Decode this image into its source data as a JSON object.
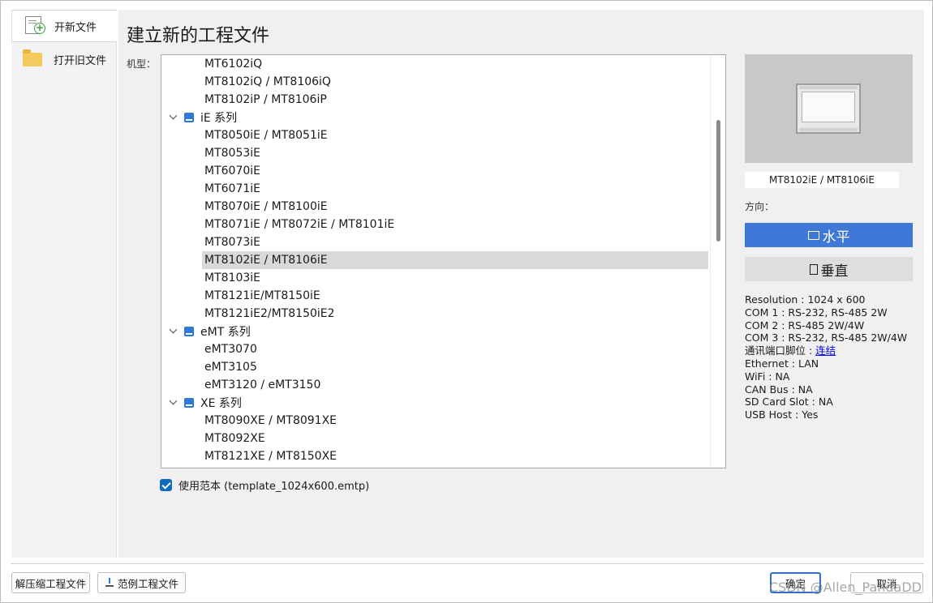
{
  "left_panel": {
    "new_file": "开新文件",
    "open_file": "打开旧文件"
  },
  "main": {
    "title": "建立新的工程文件",
    "model_label": "机型：",
    "tree": [
      {
        "type": "leaf",
        "label": "MT6102iQ"
      },
      {
        "type": "leaf",
        "label": "MT8102iQ / MT8106iQ"
      },
      {
        "type": "leaf",
        "label": "MT8102iP / MT8106iP"
      },
      {
        "type": "group",
        "label": "iE 系列"
      },
      {
        "type": "leaf",
        "label": "MT8050iE / MT8051iE"
      },
      {
        "type": "leaf",
        "label": "MT8053iE"
      },
      {
        "type": "leaf",
        "label": "MT6070iE"
      },
      {
        "type": "leaf",
        "label": "MT6071iE"
      },
      {
        "type": "leaf",
        "label": "MT8070iE / MT8100iE"
      },
      {
        "type": "leaf",
        "label": "MT8071iE / MT8072iE / MT8101iE"
      },
      {
        "type": "leaf",
        "label": "MT8073iE"
      },
      {
        "type": "leaf",
        "label": "MT8102iE / MT8106iE",
        "selected": true
      },
      {
        "type": "leaf",
        "label": "MT8103iE"
      },
      {
        "type": "leaf",
        "label": "MT8121iE/MT8150iE"
      },
      {
        "type": "leaf",
        "label": "MT8121iE2/MT8150iE2"
      },
      {
        "type": "group",
        "label": "eMT 系列"
      },
      {
        "type": "leaf",
        "label": "eMT3070"
      },
      {
        "type": "leaf",
        "label": "eMT3105"
      },
      {
        "type": "leaf",
        "label": "eMT3120 / eMT3150"
      },
      {
        "type": "group",
        "label": "XE 系列"
      },
      {
        "type": "leaf",
        "label": "MT8090XE / MT8091XE"
      },
      {
        "type": "leaf",
        "label": "MT8092XE"
      },
      {
        "type": "leaf",
        "label": "MT8121XE / MT8150XE"
      }
    ],
    "use_template": {
      "checked": true,
      "label": "使用范本 (template_1024x600.emtp)"
    }
  },
  "right": {
    "model_name": "MT8102iE / MT8106iE",
    "orientation_label": "方向：",
    "horizontal_label": "水平",
    "vertical_label": "垂直",
    "selected_orientation": "horizontal",
    "specs": [
      {
        "text": "Resolution : 1024 x 600"
      },
      {
        "text": "COM 1 : RS-232, RS-485 2W"
      },
      {
        "text": "COM 2 : RS-485 2W/4W"
      },
      {
        "text": "COM 3 : RS-232, RS-485 2W/4W"
      },
      {
        "text": "通讯端口脚位 : ",
        "link": "连结"
      },
      {
        "text": "Ethernet : LAN"
      },
      {
        "text": "WiFi : NA"
      },
      {
        "text": "CAN Bus : NA"
      },
      {
        "text": "SD Card Slot : NA"
      },
      {
        "text": "USB Host : Yes"
      }
    ]
  },
  "bottom": {
    "unzip": "解压缩工程文件",
    "examples": "范例工程文件",
    "ok": "确定",
    "cancel": "取消"
  },
  "watermark": "CSDN @Allen_PandaDD",
  "colors": {
    "accent": "#3f78d6",
    "selected_row": "#d9d9d9",
    "checkbox": "#0f6cbd"
  }
}
